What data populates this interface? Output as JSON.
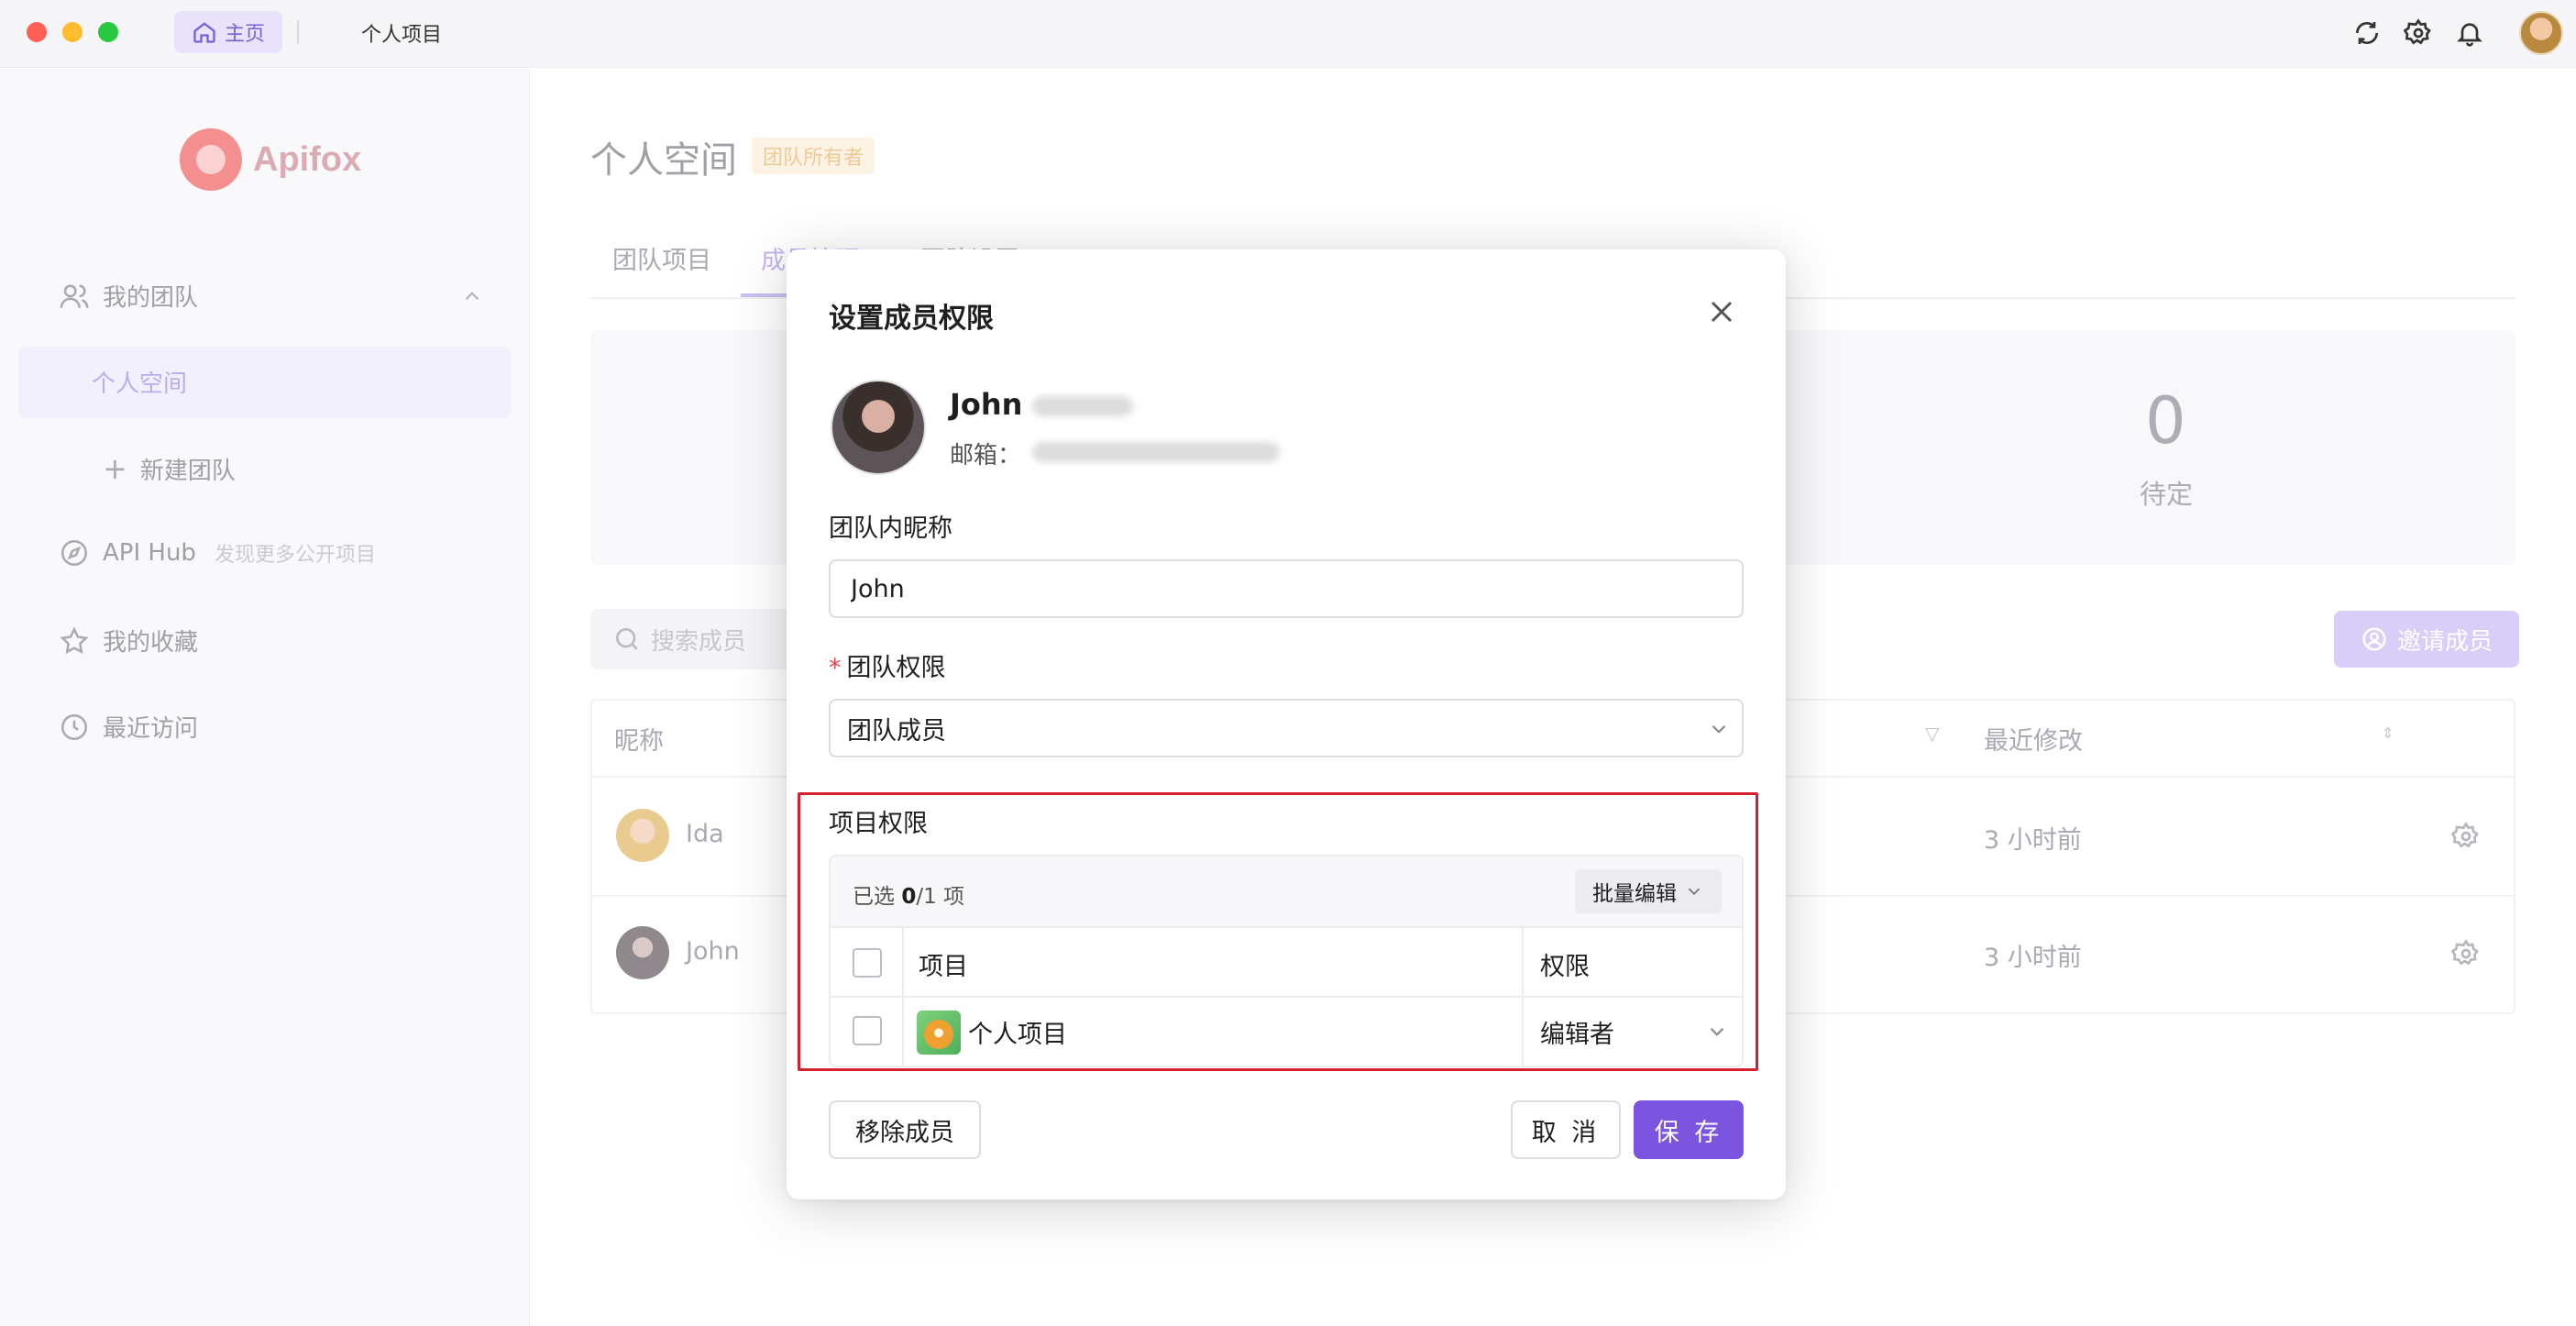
{
  "titlebar": {
    "home_tab": "主页",
    "project_tab": "个人项目",
    "icons": [
      "sync-icon",
      "gear-icon",
      "bell-icon"
    ]
  },
  "sidebar": {
    "logo_text": "Apifox",
    "my_team": "我的团队",
    "personal_space": "个人空间",
    "new_team": "新建团队",
    "api_hub": "API Hub",
    "api_hub_hint": "发现更多公开项目",
    "favorites": "我的收藏",
    "recent": "最近访问"
  },
  "main": {
    "title": "个人空间",
    "owner_badge": "团队所有者",
    "tabs": [
      "团队项目",
      "成员管理",
      "团队设置"
    ],
    "stat_value": "0",
    "stat_label": "待定",
    "search_placeholder": "搜索成员",
    "invite_button": "邀请成员",
    "table": {
      "col_nickname": "昵称",
      "col_recent": "最近修改",
      "rows": [
        {
          "name": "Ida",
          "time": "3 小时前"
        },
        {
          "name": "John",
          "time": "3 小时前"
        }
      ]
    }
  },
  "modal": {
    "title": "设置成员权限",
    "member_name": "John",
    "email_label": "邮箱：",
    "nickname_label": "团队内昵称",
    "nickname_value": "John",
    "team_permission_label": "团队权限",
    "team_permission_value": "团队成员",
    "project_permission_label": "项目权限",
    "selected_prefix": "已选 ",
    "selected_count": "0",
    "selected_suffix": "/1 项",
    "batch_edit": "批量编辑",
    "col_project": "项目",
    "col_permission": "权限",
    "rows": [
      {
        "project": "个人项目",
        "permission": "编辑者"
      }
    ],
    "remove_button": "移除成员",
    "cancel_button": "取 消",
    "save_button": "保 存"
  },
  "colors": {
    "accent": "#7b55e0",
    "highlight_border": "#d6202e"
  }
}
